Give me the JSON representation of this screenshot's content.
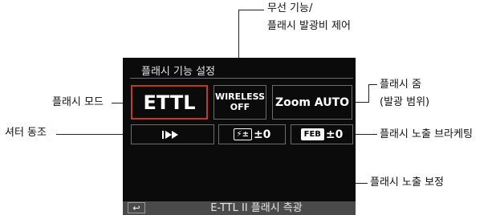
{
  "callouts": {
    "wireless_top": "무선 기능/",
    "wireless_bottom": "플래시 발광비 제어",
    "zoom_top": "플래시 줌",
    "zoom_bottom": "(발광 범위)",
    "flash_mode": "플래시 모드",
    "shutter_sync": "셔터 동조",
    "feb": "플래시 노출 브라케팅",
    "fec": "플래시 노출 보정"
  },
  "screen": {
    "title": "플래시 기능 설정",
    "ettl": "ETTL",
    "wireless_line1": "WIRELESS",
    "wireless_line2": "OFF",
    "zoom": "Zoom AUTO",
    "fec_value": "±0",
    "feb_icon": "FEB",
    "feb_value": "±0",
    "footer": "E-TTL II 플래시 측광"
  },
  "icons": {
    "shutter_sync": "second-curtain-fast-forward-icon",
    "fec": "flash-exposure-compensation-icon",
    "back": "return-icon"
  },
  "colors": {
    "selected_border": "#c0392b",
    "screen_bg": "#0b0b0b",
    "footer_bg": "#4a4a4a"
  }
}
